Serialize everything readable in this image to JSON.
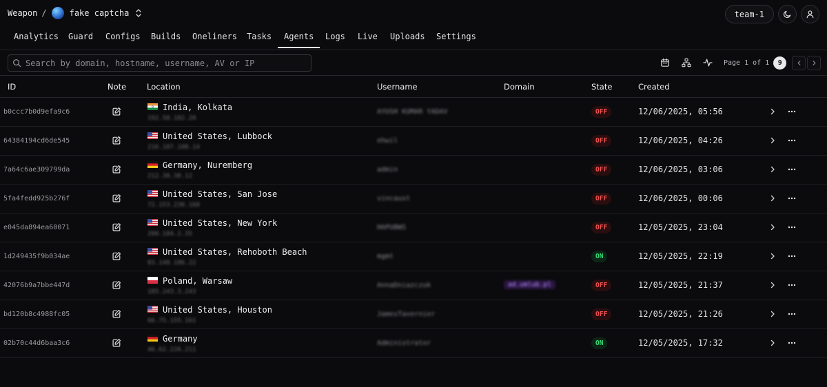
{
  "breadcrumb": {
    "org": "Weapon",
    "separator": "/",
    "project": "fake captcha"
  },
  "header": {
    "team_label": "team-1",
    "theme_icon": "moon-icon",
    "user_icon": "user-icon"
  },
  "tabs": [
    {
      "label": "Analytics"
    },
    {
      "label": "Guard"
    },
    {
      "label": "Configs"
    },
    {
      "label": "Builds"
    },
    {
      "label": "Oneliners"
    },
    {
      "label": "Tasks"
    },
    {
      "label": "Agents",
      "active": true
    },
    {
      "label": "Logs"
    },
    {
      "label": "Live"
    },
    {
      "label": "Uploads"
    },
    {
      "label": "Settings"
    }
  ],
  "search": {
    "placeholder": "Search by domain, hostname, username, AV or IP",
    "value": ""
  },
  "pager": {
    "label": "Page 1 of 1",
    "count": "9"
  },
  "table": {
    "headers": {
      "id": "ID",
      "note": "Note",
      "location": "Location",
      "username": "Username",
      "domain": "Domain",
      "state": "State",
      "created": "Created"
    },
    "rows": [
      {
        "id": "b0ccc7b0d9efa9c6",
        "flag": "in",
        "location": "India, Kolkata",
        "ip": "192.58.182.20",
        "username": "AYUSH KUMAR YADAV",
        "domain": "",
        "state": "OFF",
        "created": "12/06/2025, 05:56"
      },
      {
        "id": "64384194cd6de545",
        "flag": "us",
        "location": "United States, Lubbock",
        "ip": "216.107.108.14",
        "username": "ehwil",
        "domain": "",
        "state": "OFF",
        "created": "12/06/2025, 04:26"
      },
      {
        "id": "7a64c6ae309799da",
        "flag": "de",
        "location": "Germany, Nuremberg",
        "ip": "212.38.30.12",
        "username": "admin",
        "domain": "",
        "state": "OFF",
        "created": "12/06/2025, 03:06"
      },
      {
        "id": "5fa4fedd925b276f",
        "flag": "us",
        "location": "United States, San Jose",
        "ip": "72.153.230.168",
        "username": "vincaust",
        "domain": "",
        "state": "OFF",
        "created": "12/06/2025, 00:06"
      },
      {
        "id": "e045da894ea60071",
        "flag": "us",
        "location": "United States, New York",
        "ip": "200.104.2.35",
        "username": "HAPUBWS",
        "domain": "",
        "state": "OFF",
        "created": "12/05/2025, 23:04"
      },
      {
        "id": "1d249435f9b034ae",
        "flag": "us",
        "location": "United States, Rehoboth Beach",
        "ip": "83.148.186.22",
        "username": "mgmt",
        "domain": "",
        "state": "ON",
        "created": "12/05/2025, 22:19"
      },
      {
        "id": "42076b9a7bbe447d",
        "flag": "pl",
        "location": "Poland, Warsaw",
        "ip": "185.243.3.243",
        "username": "AnnaDniazczuk",
        "domain": "ad.umlub.pl",
        "state": "OFF",
        "created": "12/05/2025, 21:37"
      },
      {
        "id": "bd120b8c4988fc05",
        "flag": "us",
        "location": "United States, Houston",
        "ip": "66.75.155.161",
        "username": "JamesTavernier",
        "domain": "",
        "state": "OFF",
        "created": "12/05/2025, 21:26"
      },
      {
        "id": "02b70c44d6baa3c6",
        "flag": "de",
        "location": "Germany",
        "ip": "46.62.226.211",
        "username": "Administrator",
        "domain": "",
        "state": "ON",
        "created": "12/05/2025, 17:32"
      }
    ]
  },
  "colors": {
    "background": "#0b0b0d",
    "state_off": "#ef5353",
    "state_on": "#3ddc79",
    "accent_domain": "#b48cff"
  }
}
